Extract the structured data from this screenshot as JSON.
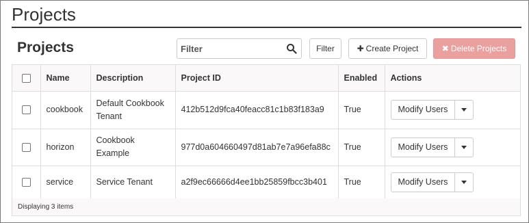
{
  "page": {
    "title": "Projects"
  },
  "section": {
    "title": "Projects"
  },
  "toolbar": {
    "filter_placeholder": "Filter",
    "filter_label": "Filter",
    "create_label": "Create Project",
    "delete_label": "Delete Projects",
    "delete_color": "#e9a09e"
  },
  "table": {
    "headers": {
      "name": "Name",
      "description": "Description",
      "project_id": "Project ID",
      "enabled": "Enabled",
      "actions": "Actions"
    },
    "rows": [
      {
        "name": "cookbook",
        "description": "Default Cookbook Tenant",
        "project_id": "412b512d9fca40feacc81c1b83f183a9",
        "enabled": "True",
        "action": "Modify Users"
      },
      {
        "name": "horizon",
        "description": "Cookbook Example",
        "project_id": "977d0a604660497d81ab7e7a96efa88c",
        "enabled": "True",
        "action": "Modify Users"
      },
      {
        "name": "service",
        "description": "Service Tenant",
        "project_id": "a2f9ec66666d4ee1bb25859fbcc3b401",
        "enabled": "True",
        "action": "Modify Users"
      }
    ],
    "footer": "Displaying 3 items"
  },
  "icons": {
    "search": "search-icon",
    "plus": "plus-icon",
    "times": "times-icon",
    "caret": "caret-down-icon"
  }
}
